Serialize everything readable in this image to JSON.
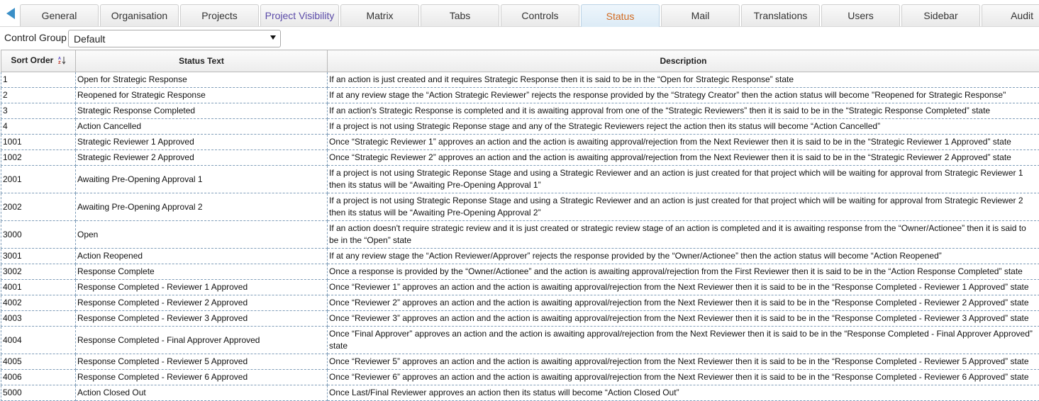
{
  "tabs": {
    "back_arrow": "left-arrow-icon",
    "items": [
      {
        "label": "General",
        "state": "normal"
      },
      {
        "label": "Organisation",
        "state": "normal"
      },
      {
        "label": "Projects",
        "state": "normal"
      },
      {
        "label": "Project Visibility",
        "state": "visited"
      },
      {
        "label": "Matrix",
        "state": "normal"
      },
      {
        "label": "Tabs",
        "state": "normal"
      },
      {
        "label": "Controls",
        "state": "normal"
      },
      {
        "label": "Status",
        "state": "active"
      },
      {
        "label": "Mail",
        "state": "normal"
      },
      {
        "label": "Translations",
        "state": "normal"
      },
      {
        "label": "Users",
        "state": "normal"
      },
      {
        "label": "Sidebar",
        "state": "normal"
      },
      {
        "label": "Audit",
        "state": "normal"
      }
    ]
  },
  "control_group": {
    "label": "Control Group",
    "selected": "Default"
  },
  "grid": {
    "headers": {
      "sort_order": "Sort Order",
      "status_text": "Status Text",
      "description": "Description"
    },
    "rows": [
      {
        "sort": "1",
        "status": "Open for Strategic Response",
        "desc": "If an action is just created and it requires Strategic Response then it is said to be in the “Open for Strategic Response” state"
      },
      {
        "sort": "2",
        "status": "Reopened for Strategic Response",
        "desc": "If at any review stage the “Action Strategic Reviewer” rejects the response provided by the “Strategy Creator” then the action status will become \"Reopened for Strategic Response\""
      },
      {
        "sort": "3",
        "status": "Strategic Response Completed",
        "desc": "If an action's Strategic Response is completed and it is awaiting approval from one of the “Strategic Reviewers” then it is said to be in the “Strategic Response Completed” state"
      },
      {
        "sort": "4",
        "status": "Action Cancelled",
        "desc": "If a project is not using Strategic Reponse stage and any of the Strategic Reviewers reject the action then its status will become “Action Cancelled”"
      },
      {
        "sort": "1001",
        "status": "Strategic Reviewer 1 Approved",
        "desc": "Once “Strategic Reviewer 1” approves an action and the action is awaiting approval/rejection from the Next Reviewer then it is said to be in the “Strategic Reviewer 1 Approved” state"
      },
      {
        "sort": "1002",
        "status": "Strategic Reviewer 2 Approved",
        "desc": "Once “Strategic Reviewer 2” approves an action and the action is awaiting approval/rejection from the Next Reviewer then it is said to be in the “Strategic Reviewer 2 Approved” state"
      },
      {
        "sort": "2001",
        "status": "Awaiting Pre-Opening Approval 1",
        "desc": "If a project is not using Strategic Reponse Stage and using a Strategic Reviewer and an action is just created for that project which will be waiting for approval from Strategic Reviewer 1 then its status will be “Awaiting Pre-Opening Approval 1”"
      },
      {
        "sort": "2002",
        "status": "Awaiting Pre-Opening Approval 2",
        "desc": "If a project is not using Strategic Reponse Stage and using a Strategic Reviewer and an action is just created for that project which will be waiting for approval from Strategic Reviewer 2 then its status will be “Awaiting Pre-Opening Approval 2”"
      },
      {
        "sort": "3000",
        "status": "Open",
        "desc": "If an action doesn't require strategic review and it is just created or strategic review stage of an action is completed and it is awaiting response from the “Owner/Actionee” then it is said to be in the “Open” state"
      },
      {
        "sort": "3001",
        "status": "Action Reopened",
        "desc": "If at any review stage the “Action Reviewer/Approver” rejects the response provided by the “Owner/Actionee” then the action status will become “Action Reopened”"
      },
      {
        "sort": "3002",
        "status": "Response Complete",
        "desc": "Once a response is provided by the “Owner/Actionee” and the action is awaiting approval/rejection from the First Reviewer then it is said to be in the “Action Response Completed” state"
      },
      {
        "sort": "4001",
        "status": "Response Completed - Reviewer 1 Approved",
        "desc": "Once “Reviewer 1” approves an action and the action is awaiting approval/rejection from the Next Reviewer then it is said to be in the “Response Completed - Reviewer 1 Approved” state"
      },
      {
        "sort": "4002",
        "status": "Response Completed - Reviewer 2 Approved",
        "desc": "Once “Reviewer 2” approves an action and the action is awaiting approval/rejection from the Next Reviewer then it is said to be in the “Response Completed - Reviewer 2 Approved” state"
      },
      {
        "sort": "4003",
        "status": "Response Completed - Reviewer 3 Approved",
        "desc": "Once “Reviewer 3” approves an action and the action is awaiting approval/rejection from the Next Reviewer then it is said to be in the “Response Completed - Reviewer 3 Approved” state"
      },
      {
        "sort": "4004",
        "status": "Response Completed - Final Approver Approved",
        "desc": "Once “Final Approver” approves an action and the action is awaiting approval/rejection from the Next Reviewer then it is said to be in the “Response Completed - Final Approver Approved” state"
      },
      {
        "sort": "4005",
        "status": "Response Completed - Reviewer 5 Approved",
        "desc": "Once “Reviewer 5” approves an action and the action is awaiting approval/rejection from the Next Reviewer then it is said to be in the “Response Completed - Reviewer 5 Approved” state"
      },
      {
        "sort": "4006",
        "status": "Response Completed - Reviewer 6 Approved",
        "desc": "Once “Reviewer 6” approves an action and the action is awaiting approval/rejection from the Next Reviewer then it is said to be in the “Response Completed - Reviewer 6 Approved” state"
      },
      {
        "sort": "5000",
        "status": "Action Closed Out",
        "desc": "Once Last/Final Reviewer approves an action then its status will become “Action Closed Out”"
      }
    ]
  }
}
